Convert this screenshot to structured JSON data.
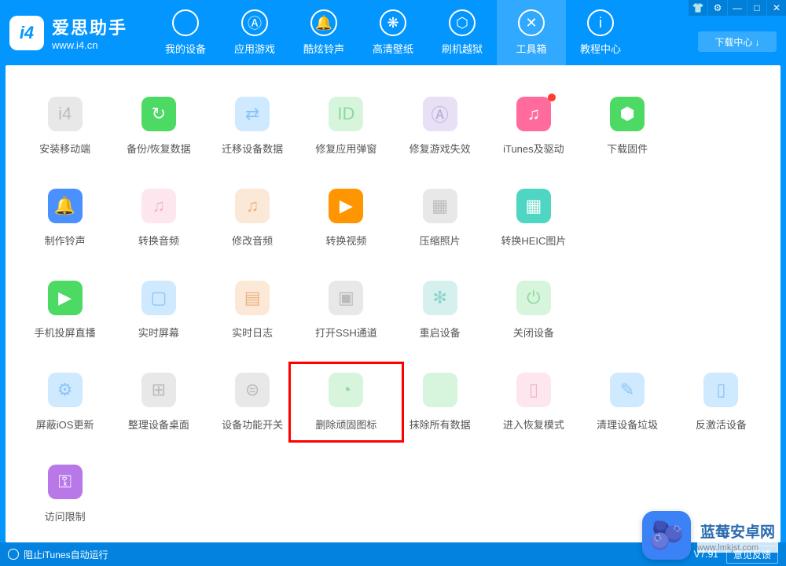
{
  "header": {
    "logo_badge": "i4",
    "logo_cn": "爱思助手",
    "logo_url": "www.i4.cn",
    "download_center": "下载中心 ↓",
    "nav": [
      {
        "label": "我的设备",
        "icon": ""
      },
      {
        "label": "应用游戏",
        "icon": "Ⓐ"
      },
      {
        "label": "酷炫铃声",
        "icon": "🔔"
      },
      {
        "label": "高清壁纸",
        "icon": "❋"
      },
      {
        "label": "刷机越狱",
        "icon": "⬡"
      },
      {
        "label": "工具箱",
        "icon": "✕"
      },
      {
        "label": "教程中心",
        "icon": "i"
      }
    ],
    "active_nav_index": 5
  },
  "tools": [
    {
      "label": "安装移动端",
      "icon": "i4",
      "cls": "c-grey"
    },
    {
      "label": "备份/恢复数据",
      "icon": "↻",
      "cls": "c-green"
    },
    {
      "label": "迁移设备数据",
      "icon": "⇄",
      "cls": "c-lblue"
    },
    {
      "label": "修复应用弹窗",
      "icon": "ID",
      "cls": "c-lgreen"
    },
    {
      "label": "修复游戏失效",
      "icon": "Ⓐ",
      "cls": "c-lpurple"
    },
    {
      "label": "iTunes及驱动",
      "icon": "♫",
      "cls": "c-pink",
      "dot": true
    },
    {
      "label": "下载固件",
      "icon": "⬢",
      "cls": "c-green"
    },
    {
      "label": "",
      "icon": "",
      "cls": "",
      "empty": true
    },
    {
      "label": "制作铃声",
      "icon": "🔔",
      "cls": "c-blue"
    },
    {
      "label": "转换音频",
      "icon": "♫",
      "cls": "c-lpink"
    },
    {
      "label": "修改音频",
      "icon": "♫",
      "cls": "c-lorange"
    },
    {
      "label": "转换视频",
      "icon": "▶",
      "cls": "c-orange"
    },
    {
      "label": "压缩照片",
      "icon": "▦",
      "cls": "c-grey"
    },
    {
      "label": "转换HEIC图片",
      "icon": "▦",
      "cls": "c-teal"
    },
    {
      "label": "",
      "icon": "",
      "cls": "",
      "empty": true
    },
    {
      "label": "",
      "icon": "",
      "cls": "",
      "empty": true
    },
    {
      "label": "手机投屏直播",
      "icon": "▶",
      "cls": "c-green"
    },
    {
      "label": "实时屏幕",
      "icon": "▢",
      "cls": "c-lblue"
    },
    {
      "label": "实时日志",
      "icon": "▤",
      "cls": "c-lorange"
    },
    {
      "label": "打开SSH通道",
      "icon": "▣",
      "cls": "c-grey"
    },
    {
      "label": "重启设备",
      "icon": "✻",
      "cls": "c-lteal"
    },
    {
      "label": "关闭设备",
      "icon": "⏻",
      "cls": "c-lgreen"
    },
    {
      "label": "",
      "icon": "",
      "cls": "",
      "empty": true
    },
    {
      "label": "",
      "icon": "",
      "cls": "",
      "empty": true
    },
    {
      "label": "屏蔽iOS更新",
      "icon": "⚙",
      "cls": "c-lblue"
    },
    {
      "label": "整理设备桌面",
      "icon": "⊞",
      "cls": "c-grey"
    },
    {
      "label": "设备功能开关",
      "icon": "⊜",
      "cls": "c-grey"
    },
    {
      "label": "删除顽固图标",
      "icon": "◔",
      "cls": "c-lgreen",
      "highlighted": true
    },
    {
      "label": "抹除所有数据",
      "icon": "",
      "cls": "c-lgreen"
    },
    {
      "label": "进入恢复模式",
      "icon": "▯",
      "cls": "c-lpink"
    },
    {
      "label": "清理设备垃圾",
      "icon": "✎",
      "cls": "c-lblue"
    },
    {
      "label": "反激活设备",
      "icon": "▯",
      "cls": "c-lblue"
    },
    {
      "label": "访问限制",
      "icon": "⚿",
      "cls": "c-purple"
    }
  ],
  "footer": {
    "block_itunes": "阻止iTunes自动运行",
    "version": "V7.91",
    "feedback": "意见反馈"
  },
  "watermark": {
    "emoji": "🫐",
    "text": "蓝莓安卓网",
    "url": "www.lmkjst.com"
  }
}
